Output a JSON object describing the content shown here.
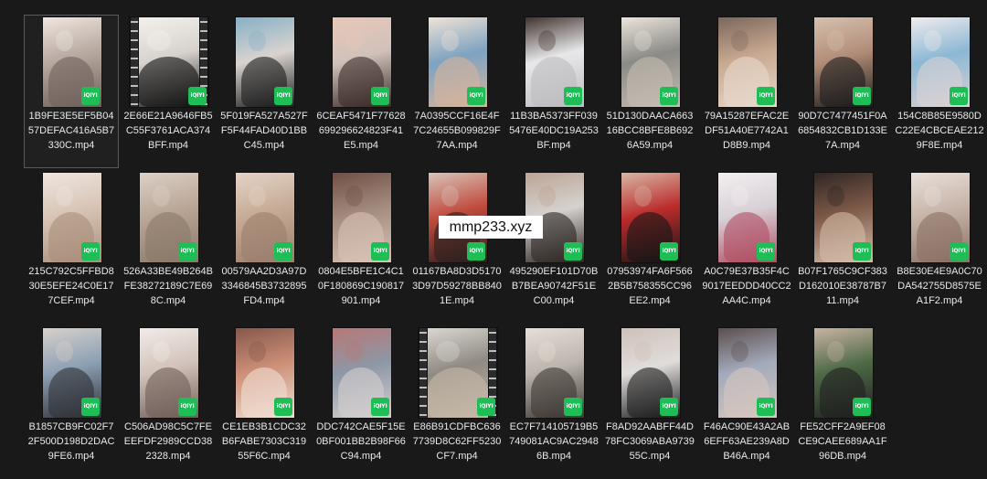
{
  "files": [
    {
      "name": "1B9FE3E5EF5B0457DEFAC416A5B7330C.mp4",
      "badge": "iQIYI",
      "selected": true,
      "filmstrip": false,
      "palette": [
        "#b7a8a0",
        "#6f625b",
        "#efe7e0"
      ]
    },
    {
      "name": "2E66E21A9646FB5C55F3761ACA374BFF.mp4",
      "badge": "iQIYI",
      "selected": false,
      "filmstrip": true,
      "palette": [
        "#d7d2cd",
        "#111111",
        "#f5f2ee"
      ]
    },
    {
      "name": "5F019FA527A527FF5F44FAD40D1BBC45.mp4",
      "badge": "iQIYI",
      "selected": false,
      "filmstrip": false,
      "palette": [
        "#d9d3cf",
        "#1d1d1d",
        "#86b0c6"
      ]
    },
    {
      "name": "6CEAF5471F77628699296624823F41E5.mp4",
      "badge": "iQIYI",
      "selected": false,
      "filmstrip": false,
      "palette": [
        "#d1c1bb",
        "#3b2c29",
        "#e7c8b8"
      ]
    },
    {
      "name": "7A0395CCF16E4F7C24655B099829F7AA.mp4",
      "badge": "iQIYI",
      "selected": false,
      "filmstrip": false,
      "palette": [
        "#7ea3c1",
        "#d6b49d",
        "#f0e3d7"
      ]
    },
    {
      "name": "11B3BA5373FF0395476E40DC19A253BF.mp4",
      "badge": "iQIYI",
      "selected": false,
      "filmstrip": false,
      "palette": [
        "#e8e8ea",
        "#bdbcc0",
        "#40332f"
      ]
    },
    {
      "name": "51D130DAACA66316BCC8BFE8B6926A59.mp4",
      "badge": "iQIYI",
      "selected": false,
      "filmstrip": false,
      "palette": [
        "#8b8a86",
        "#c5bcb2",
        "#ebe6dd"
      ]
    },
    {
      "name": "79A15287EFAC2EDF51A40E7742A1D8B9.mp4",
      "badge": "iQIYI",
      "selected": false,
      "filmstrip": false,
      "palette": [
        "#c8a991",
        "#e8d8cb",
        "#7b675c"
      ]
    },
    {
      "name": "90D7C7477451F0A6854832CB1D133E7A.mp4",
      "badge": "iQIYI",
      "selected": false,
      "filmstrip": false,
      "palette": [
        "#b18d78",
        "#1c1c1c",
        "#d6c0af"
      ]
    },
    {
      "name": "154C8B85E9580DC22E4CBCEAE2129F8E.mp4",
      "badge": "iQIYI",
      "selected": false,
      "filmstrip": false,
      "palette": [
        "#8cb8d4",
        "#d9d2d4",
        "#f1ecee"
      ]
    },
    {
      "name": "215C792C5FFBD830E5EFE24C0E177CEF.mp4",
      "badge": "iQIYI",
      "selected": false,
      "filmstrip": false,
      "palette": [
        "#d8c4b6",
        "#a98f7b",
        "#efe6df"
      ]
    },
    {
      "name": "526A33BE49B264BFE38272189C7E698C.mp4",
      "badge": "iQIYI",
      "selected": false,
      "filmstrip": false,
      "palette": [
        "#b9a696",
        "#8a7869",
        "#ddd0c6"
      ]
    },
    {
      "name": "00579AA2D3A97D3346845B3732895FD4.mp4",
      "badge": "iQIYI",
      "selected": false,
      "filmstrip": false,
      "palette": [
        "#c6ab96",
        "#9b7f6d",
        "#e4d3c7"
      ]
    },
    {
      "name": "0804E5BFE1C4C10F180869C190817901.mp4",
      "badge": "iQIYI",
      "selected": false,
      "filmstrip": false,
      "palette": [
        "#a38b80",
        "#d8c2b5",
        "#704f44"
      ]
    },
    {
      "name": "01167BA8D3D51703D97D59278BB8401E.mp4",
      "badge": "iQIYI",
      "selected": false,
      "filmstrip": false,
      "palette": [
        "#c04b3e",
        "#2a1f1e",
        "#d8c4b8"
      ]
    },
    {
      "name": "495290EF101D70BB7BEA90742F51EC00.mp4",
      "badge": "iQIYI",
      "selected": false,
      "filmstrip": false,
      "palette": [
        "#d5d2cf",
        "#2d2623",
        "#bca495"
      ]
    },
    {
      "name": "07953974FA6F5662B5B758355CC96EE2.mp4",
      "badge": "iQIYI",
      "selected": false,
      "filmstrip": false,
      "palette": [
        "#bb2c2c",
        "#151515",
        "#d8b6a5"
      ]
    },
    {
      "name": "A0C79E37B35F4C9017EEDDD40CC2AA4C.mp4",
      "badge": "iQIYI",
      "selected": false,
      "filmstrip": false,
      "palette": [
        "#d7d0d6",
        "#b14c62",
        "#f3eff0"
      ]
    },
    {
      "name": "B07F1765C9CF383D162010E38787B711.mp4",
      "badge": "iQIYI",
      "selected": false,
      "filmstrip": false,
      "palette": [
        "#7e5a49",
        "#d4bca9",
        "#2f2623"
      ]
    },
    {
      "name": "B8E30E4E9A0C70DA542755D8575EA1F2.mp4",
      "badge": "iQIYI",
      "selected": false,
      "filmstrip": false,
      "palette": [
        "#c7b4a9",
        "#8a7064",
        "#e8e0da"
      ]
    },
    {
      "name": "B1857CB9FC02F72F500D198D2DAC9FE6.mp4",
      "badge": "iQIYI",
      "selected": false,
      "filmstrip": false,
      "palette": [
        "#8da0b4",
        "#2f3136",
        "#d7d1cb"
      ]
    },
    {
      "name": "C506AD98C5C7FEEEFDF2989CCD382328.mp4",
      "badge": "iQIYI",
      "selected": false,
      "filmstrip": false,
      "palette": [
        "#d2c3bb",
        "#6f5f58",
        "#f1ebe8"
      ]
    },
    {
      "name": "CE1EB3B1CDC32B6FABE7303C31955F6C.mp4",
      "badge": "iQIYI",
      "selected": false,
      "filmstrip": false,
      "palette": [
        "#cc8f77",
        "#f0ddd2",
        "#86574b"
      ]
    },
    {
      "name": "DDC742CAE5F15E0BF001BB2B98F66C94.mp4",
      "badge": "iQIYI",
      "selected": false,
      "filmstrip": false,
      "palette": [
        "#8d97a6",
        "#d4cfcf",
        "#b87876"
      ]
    },
    {
      "name": "E86B91CDFBC6367739D8C62FF5230CF7.mp4",
      "badge": "iQIYI",
      "selected": false,
      "filmstrip": true,
      "palette": [
        "#8f8a83",
        "#c7b9a8",
        "#dedad5"
      ]
    },
    {
      "name": "EC7F714105719B5749081AC9AC29486B.mp4",
      "badge": "iQIYI",
      "selected": false,
      "filmstrip": false,
      "palette": [
        "#bcb5ad",
        "#3d3834",
        "#e5dfd8"
      ]
    },
    {
      "name": "F8AD92AABFF44D78FC3069ABA973955C.mp4",
      "badge": "iQIYI",
      "selected": false,
      "filmstrip": false,
      "palette": [
        "#e0dddb",
        "#1d1d1d",
        "#cfc1b9"
      ]
    },
    {
      "name": "F46AC90E43A2AB6EFF63AE239A8DB46A.mp4",
      "badge": "iQIYI",
      "selected": false,
      "filmstrip": false,
      "palette": [
        "#a3aabb",
        "#d6c6bf",
        "#5c4f4f"
      ]
    },
    {
      "name": "FE52CFF2A9EF08CE9CAEE689AA1F96DB.mp4",
      "badge": "iQIYI",
      "selected": false,
      "filmstrip": false,
      "palette": [
        "#4f6a47",
        "#1f1f1f",
        "#c9b4a3"
      ]
    }
  ],
  "watermark": "mmp233.xyz",
  "colors": {
    "background": "#191919",
    "text": "#e9e9e9",
    "badge": "#1fbd56",
    "selection_border": "#5a5a5a"
  }
}
